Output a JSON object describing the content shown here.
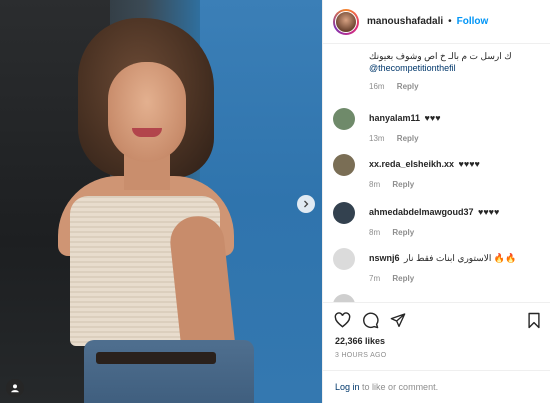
{
  "post": {
    "username": "manoushafadali",
    "separator": "•",
    "follow_label": "Follow"
  },
  "first_comment": {
    "text": "ك ارسل ت م بالـ خ اص وشوف بعيونك",
    "mention": "@thecompetitionthefil",
    "time": "16m",
    "reply_label": "Reply"
  },
  "comments": [
    {
      "username": "hanyalam11",
      "text": "♥♥♥",
      "time": "13m",
      "reply_label": "Reply",
      "avatar_color": "#6f8a6a"
    },
    {
      "username": "xx.reda_elsheikh.xx",
      "text": "♥♥♥♥",
      "time": "8m",
      "reply_label": "Reply",
      "avatar_color": "#7a6e55"
    },
    {
      "username": "ahmedabdelmawgoud37",
      "text": "♥♥♥♥",
      "time": "8m",
      "reply_label": "Reply",
      "avatar_color": "#33414f"
    },
    {
      "username": "nswnj6",
      "text": "الاستوري ابنات فقط نار 🔥🔥",
      "time": "7m",
      "reply_label": "Reply",
      "avatar_color": "#dbdbdb"
    },
    {
      "username": "",
      "text": "",
      "time": "",
      "reply_label": "Reply",
      "avatar_color": "#cfcfcf"
    }
  ],
  "likes": "22,366 likes",
  "timestamp": "3 HOURS AGO",
  "login": {
    "link_label": "Log in",
    "suffix": "to like or comment."
  },
  "colors": {
    "accent": "#0095f6",
    "text": "#262626",
    "muted": "#8e8e8e",
    "link": "#00376b"
  },
  "icons": [
    "heart-icon",
    "comment-icon",
    "share-icon",
    "save-icon",
    "chevron-right-icon",
    "user-tag-icon"
  ]
}
